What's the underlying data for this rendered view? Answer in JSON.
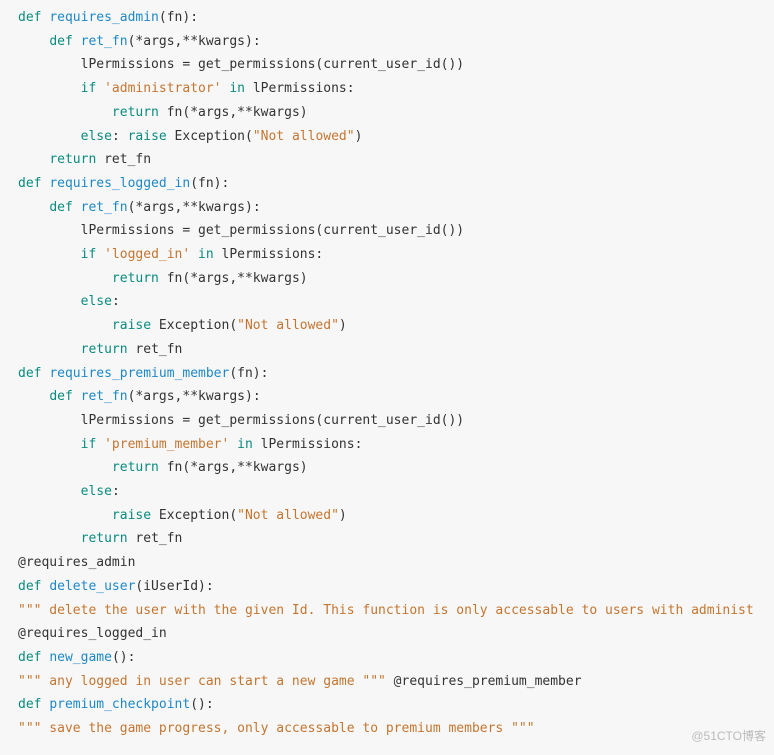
{
  "watermark": "@51CTO博客",
  "code": {
    "lines": [
      [
        {
          "t": "def ",
          "c": "kw"
        },
        {
          "t": "requires_admin",
          "c": "fn"
        },
        {
          "t": "(fn):",
          "c": "id"
        }
      ],
      [
        {
          "t": "    ",
          "c": "id"
        },
        {
          "t": "def ",
          "c": "kw"
        },
        {
          "t": "ret_fn",
          "c": "fn"
        },
        {
          "t": "(*args,**kwargs):",
          "c": "id"
        }
      ],
      [
        {
          "t": "        lPermissions = get_permissions(current_user_id())",
          "c": "id"
        }
      ],
      [
        {
          "t": "        ",
          "c": "id"
        },
        {
          "t": "if ",
          "c": "kw"
        },
        {
          "t": "'administrator'",
          "c": "str"
        },
        {
          "t": " ",
          "c": "id"
        },
        {
          "t": "in",
          "c": "kw"
        },
        {
          "t": " lPermissions:",
          "c": "id"
        }
      ],
      [
        {
          "t": "            ",
          "c": "id"
        },
        {
          "t": "return",
          "c": "kw"
        },
        {
          "t": " fn(*args,**kwargs)",
          "c": "id"
        }
      ],
      [
        {
          "t": "        ",
          "c": "id"
        },
        {
          "t": "else",
          "c": "kw"
        },
        {
          "t": ": ",
          "c": "id"
        },
        {
          "t": "raise",
          "c": "kw"
        },
        {
          "t": " Exception(",
          "c": "id"
        },
        {
          "t": "\"Not allowed\"",
          "c": "str"
        },
        {
          "t": ")",
          "c": "id"
        }
      ],
      [
        {
          "t": "    ",
          "c": "id"
        },
        {
          "t": "return",
          "c": "kw"
        },
        {
          "t": " ret_fn",
          "c": "id"
        }
      ],
      [
        {
          "t": "def ",
          "c": "kw"
        },
        {
          "t": "requires_logged_in",
          "c": "fn"
        },
        {
          "t": "(fn):",
          "c": "id"
        }
      ],
      [
        {
          "t": "    ",
          "c": "id"
        },
        {
          "t": "def ",
          "c": "kw"
        },
        {
          "t": "ret_fn",
          "c": "fn"
        },
        {
          "t": "(*args,**kwargs):",
          "c": "id"
        }
      ],
      [
        {
          "t": "        lPermissions = get_permissions(current_user_id())",
          "c": "id"
        }
      ],
      [
        {
          "t": "        ",
          "c": "id"
        },
        {
          "t": "if ",
          "c": "kw"
        },
        {
          "t": "'logged_in'",
          "c": "str"
        },
        {
          "t": " ",
          "c": "id"
        },
        {
          "t": "in",
          "c": "kw"
        },
        {
          "t": " lPermissions:",
          "c": "id"
        }
      ],
      [
        {
          "t": "            ",
          "c": "id"
        },
        {
          "t": "return",
          "c": "kw"
        },
        {
          "t": " fn(*args,**kwargs)",
          "c": "id"
        }
      ],
      [
        {
          "t": "        ",
          "c": "id"
        },
        {
          "t": "else",
          "c": "kw"
        },
        {
          "t": ":",
          "c": "id"
        }
      ],
      [
        {
          "t": "            ",
          "c": "id"
        },
        {
          "t": "raise",
          "c": "kw"
        },
        {
          "t": " Exception(",
          "c": "id"
        },
        {
          "t": "\"Not allowed\"",
          "c": "str"
        },
        {
          "t": ")",
          "c": "id"
        }
      ],
      [
        {
          "t": "        ",
          "c": "id"
        },
        {
          "t": "return",
          "c": "kw"
        },
        {
          "t": " ret_fn",
          "c": "id"
        }
      ],
      [
        {
          "t": "def ",
          "c": "kw"
        },
        {
          "t": "requires_premium_member",
          "c": "fn"
        },
        {
          "t": "(fn):",
          "c": "id"
        }
      ],
      [
        {
          "t": "    ",
          "c": "id"
        },
        {
          "t": "def ",
          "c": "kw"
        },
        {
          "t": "ret_fn",
          "c": "fn"
        },
        {
          "t": "(*args,**kwargs):",
          "c": "id"
        }
      ],
      [
        {
          "t": "        lPermissions = get_permissions(current_user_id())",
          "c": "id"
        }
      ],
      [
        {
          "t": "        ",
          "c": "id"
        },
        {
          "t": "if ",
          "c": "kw"
        },
        {
          "t": "'premium_member'",
          "c": "str"
        },
        {
          "t": " ",
          "c": "id"
        },
        {
          "t": "in",
          "c": "kw"
        },
        {
          "t": " lPermissions:",
          "c": "id"
        }
      ],
      [
        {
          "t": "            ",
          "c": "id"
        },
        {
          "t": "return",
          "c": "kw"
        },
        {
          "t": " fn(*args,**kwargs)",
          "c": "id"
        }
      ],
      [
        {
          "t": "        ",
          "c": "id"
        },
        {
          "t": "else",
          "c": "kw"
        },
        {
          "t": ":",
          "c": "id"
        }
      ],
      [
        {
          "t": "            ",
          "c": "id"
        },
        {
          "t": "raise",
          "c": "kw"
        },
        {
          "t": " Exception(",
          "c": "id"
        },
        {
          "t": "\"Not allowed\"",
          "c": "str"
        },
        {
          "t": ")",
          "c": "id"
        }
      ],
      [
        {
          "t": "        ",
          "c": "id"
        },
        {
          "t": "return",
          "c": "kw"
        },
        {
          "t": " ret_fn",
          "c": "id"
        }
      ],
      [
        {
          "t": "@requires_admin",
          "c": "id"
        }
      ],
      [
        {
          "t": "def ",
          "c": "kw"
        },
        {
          "t": "delete_user",
          "c": "fn"
        },
        {
          "t": "(iUserId):",
          "c": "id"
        }
      ],
      [
        {
          "t": "\"\"\" delete the user with the given Id. This function is only accessable to users with administ",
          "c": "str"
        }
      ],
      [
        {
          "t": "@requires_logged_in",
          "c": "id"
        }
      ],
      [
        {
          "t": "def ",
          "c": "kw"
        },
        {
          "t": "new_game",
          "c": "fn"
        },
        {
          "t": "():",
          "c": "id"
        }
      ],
      [
        {
          "t": "\"\"\" any logged in user can start a new game \"\"\"",
          "c": "str"
        },
        {
          "t": " @requires_premium_member",
          "c": "id"
        }
      ],
      [
        {
          "t": "def ",
          "c": "kw"
        },
        {
          "t": "premium_checkpoint",
          "c": "fn"
        },
        {
          "t": "():",
          "c": "id"
        }
      ],
      [
        {
          "t": "\"\"\" save the game progress, only accessable to premium members \"\"\"",
          "c": "str"
        }
      ]
    ]
  }
}
